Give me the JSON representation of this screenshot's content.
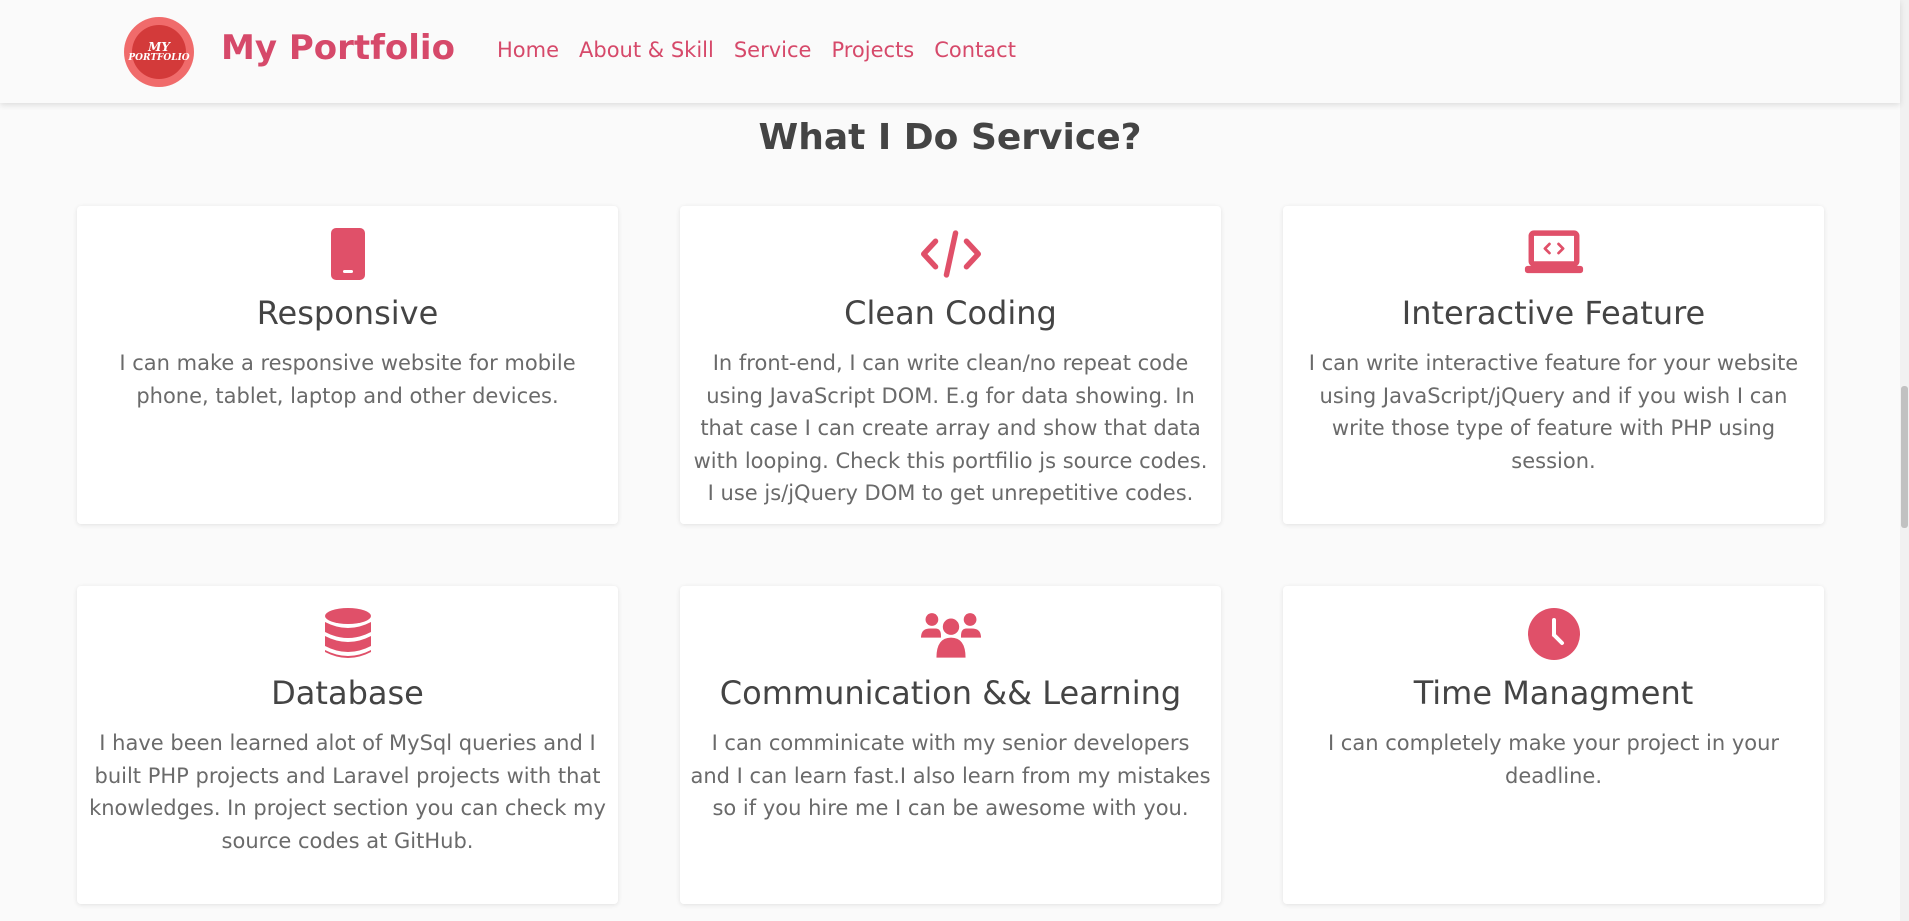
{
  "colors": {
    "accent": "#d6496a",
    "logo_outer": "#f06b6b",
    "logo_inner": "#d33a3a"
  },
  "header": {
    "logo": {
      "line1": "MY",
      "line2": "PORTFOLIO"
    },
    "brand": "My Portfolio",
    "menu": [
      "Home",
      "About & Skill",
      "Service",
      "Projects",
      "Contact"
    ]
  },
  "section": {
    "title": "What I Do Service?",
    "services": [
      {
        "icon": "tablet-icon",
        "title": "Responsive",
        "text": "I can make a responsive website for mobile phone, tablet, laptop and other devices."
      },
      {
        "icon": "code-icon",
        "title": "Clean Coding",
        "text": "In front-end, I can write clean/no repeat code using JavaScript DOM. E.g for data showing. In that case I can create array and show that data with looping. Check this portfilio js source codes. I use js/jQuery DOM to get unrepetitive codes."
      },
      {
        "icon": "laptop-code-icon",
        "title": "Interactive Feature",
        "text": "I can write interactive feature for your website using JavaScript/jQuery and if you wish I can write those type of feature with PHP using session."
      },
      {
        "icon": "database-icon",
        "title": "Database",
        "text": "I have been learned alot of MySql queries and I built PHP projects and Laravel projects with that knowledges. In project section you can check my source codes at GitHub."
      },
      {
        "icon": "users-icon",
        "title": "Communication && Learning",
        "text": "I can comminicate with my senior developers and I can learn fast.I also learn from my mistakes so if you hire me I can be awesome with you."
      },
      {
        "icon": "clock-icon",
        "title": "Time Managment",
        "text": "I can completely make your project in your deadline."
      }
    ]
  }
}
